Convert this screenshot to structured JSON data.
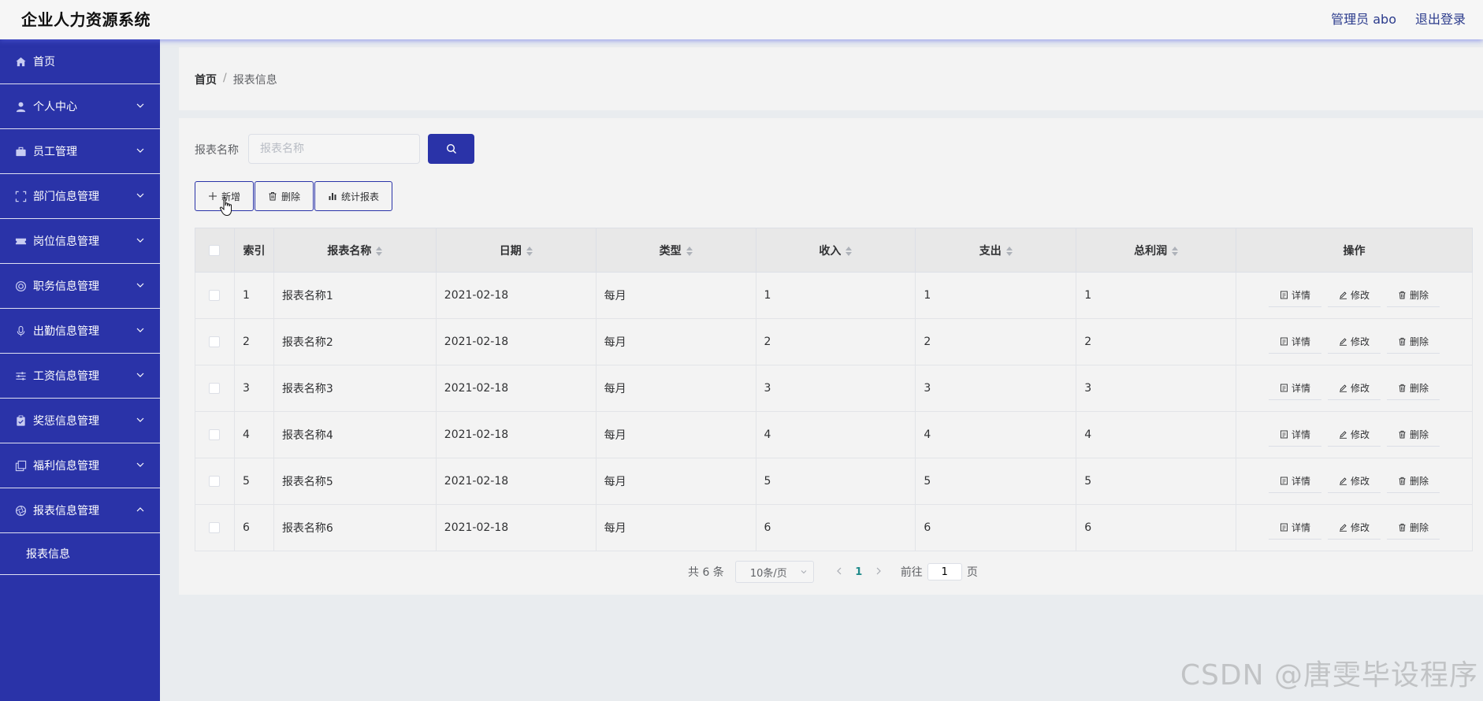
{
  "header": {
    "title": "企业人力资源系统",
    "user_label": "管理员 abo",
    "logout_label": "退出登录"
  },
  "sidebar": {
    "items": [
      {
        "label": "首页",
        "icon": "home-icon",
        "expandable": false
      },
      {
        "label": "个人中心",
        "icon": "user-icon",
        "expandable": true
      },
      {
        "label": "员工管理",
        "icon": "briefcase-icon",
        "expandable": true
      },
      {
        "label": "部门信息管理",
        "icon": "frame-icon",
        "expandable": true
      },
      {
        "label": "岗位信息管理",
        "icon": "ticket-icon",
        "expandable": true
      },
      {
        "label": "职务信息管理",
        "icon": "lifebuoy-icon",
        "expandable": true
      },
      {
        "label": "出勤信息管理",
        "icon": "microphone-icon",
        "expandable": true
      },
      {
        "label": "工资信息管理",
        "icon": "sliders-icon",
        "expandable": true
      },
      {
        "label": "奖惩信息管理",
        "icon": "clipboard-icon",
        "expandable": true
      },
      {
        "label": "福利信息管理",
        "icon": "copy-icon",
        "expandable": true
      },
      {
        "label": "报表信息管理",
        "icon": "aperture-icon",
        "expandable": true,
        "expanded": true
      }
    ],
    "submenu": [
      {
        "label": "报表信息"
      }
    ]
  },
  "breadcrumb": {
    "home": "首页",
    "separator": "/",
    "current": "报表信息"
  },
  "search": {
    "label": "报表名称",
    "placeholder": "报表名称",
    "value": ""
  },
  "toolbar": {
    "add_label": "新增",
    "delete_label": "删除",
    "stats_label": "统计报表"
  },
  "table": {
    "columns": [
      {
        "label": "索引",
        "sortable": false
      },
      {
        "label": "报表名称",
        "sortable": true
      },
      {
        "label": "日期",
        "sortable": true
      },
      {
        "label": "类型",
        "sortable": true
      },
      {
        "label": "收入",
        "sortable": true
      },
      {
        "label": "支出",
        "sortable": true
      },
      {
        "label": "总利润",
        "sortable": true
      },
      {
        "label": "操作",
        "sortable": false
      }
    ],
    "rows": [
      {
        "index": "1",
        "name": "报表名称1",
        "date": "2021-02-18",
        "type": "每月",
        "income": "1",
        "expense": "1",
        "profit": "1"
      },
      {
        "index": "2",
        "name": "报表名称2",
        "date": "2021-02-18",
        "type": "每月",
        "income": "2",
        "expense": "2",
        "profit": "2"
      },
      {
        "index": "3",
        "name": "报表名称3",
        "date": "2021-02-18",
        "type": "每月",
        "income": "3",
        "expense": "3",
        "profit": "3"
      },
      {
        "index": "4",
        "name": "报表名称4",
        "date": "2021-02-18",
        "type": "每月",
        "income": "4",
        "expense": "4",
        "profit": "4"
      },
      {
        "index": "5",
        "name": "报表名称5",
        "date": "2021-02-18",
        "type": "每月",
        "income": "5",
        "expense": "5",
        "profit": "5"
      },
      {
        "index": "6",
        "name": "报表名称6",
        "date": "2021-02-18",
        "type": "每月",
        "income": "6",
        "expense": "6",
        "profit": "6"
      }
    ],
    "row_actions": {
      "detail": "详情",
      "edit": "修改",
      "delete": "删除"
    }
  },
  "pagination": {
    "total": "共 6 条",
    "page_size": "10条/页",
    "current_page": "1",
    "goto_prefix": "前往",
    "goto_value": "1",
    "goto_suffix": "页"
  },
  "watermark": "CSDN @唐雯毕设程序",
  "colors": {
    "primary": "#2a33a8",
    "page_bg": "#e9ecef",
    "card_bg": "#f3f3f3",
    "active_page": "#1f8a8a"
  }
}
